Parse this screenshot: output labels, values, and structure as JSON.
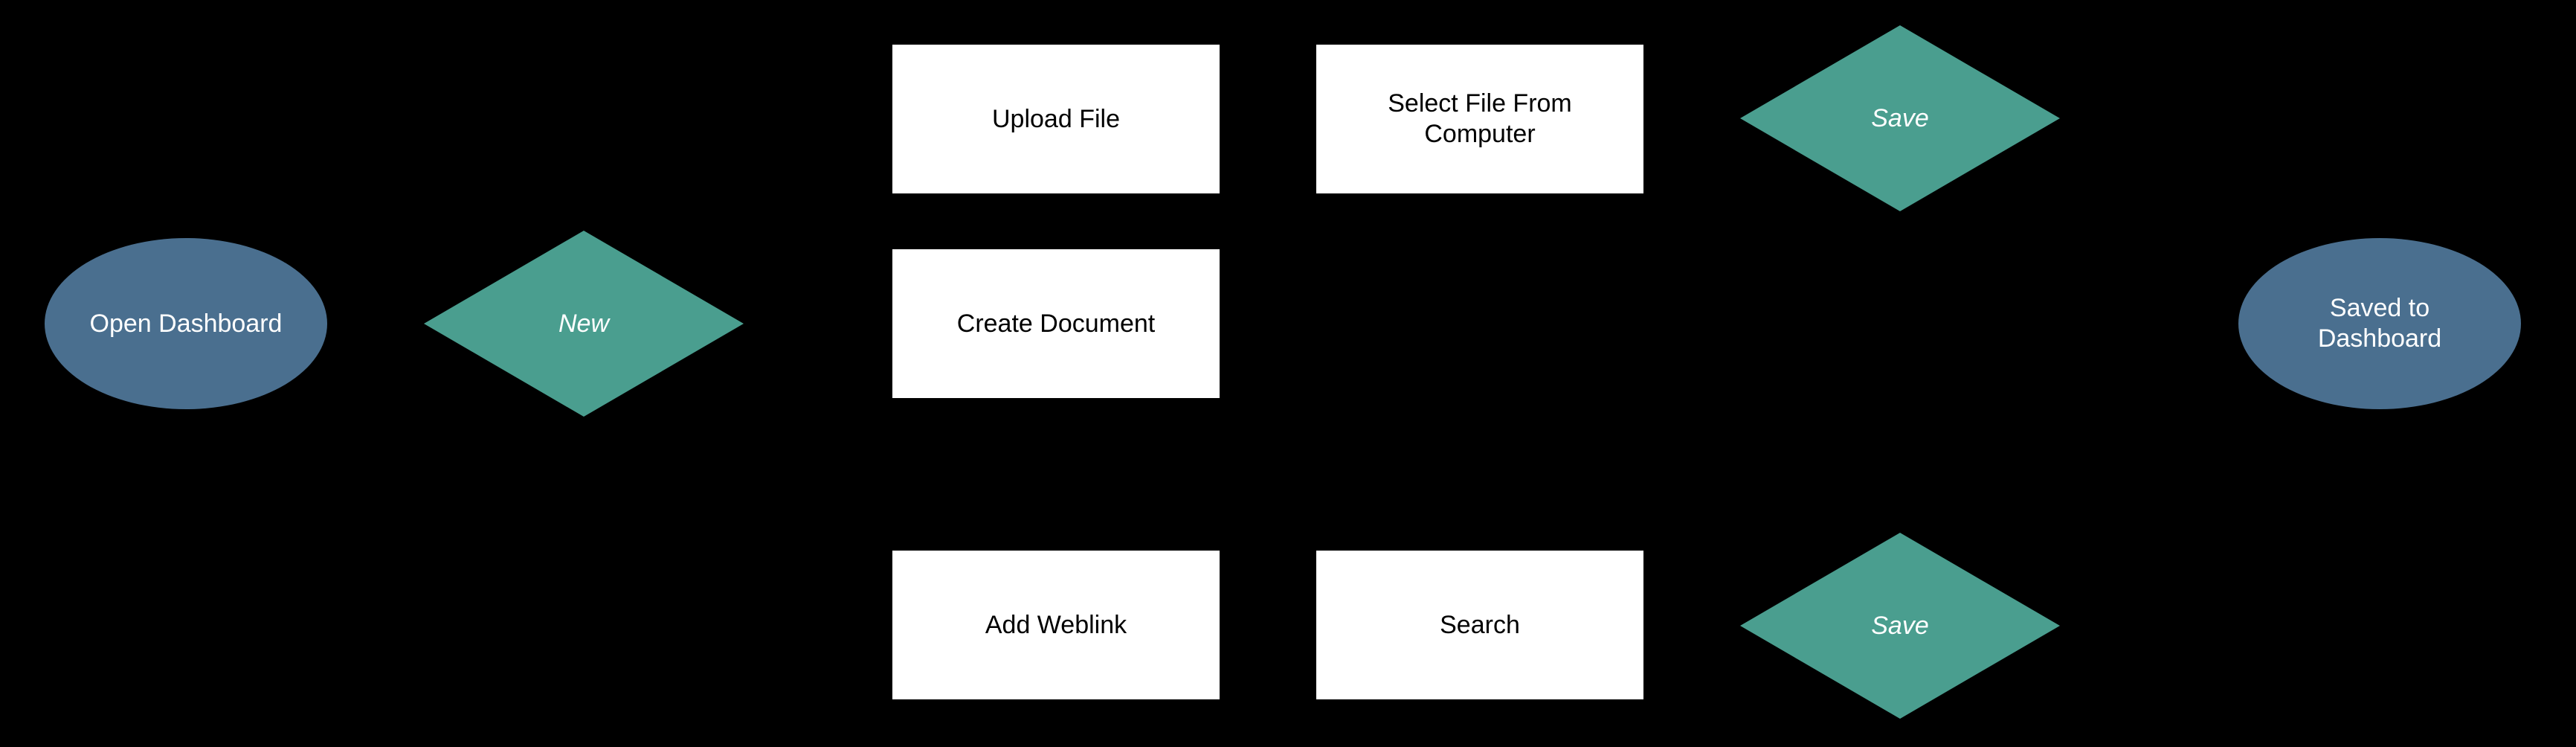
{
  "colors": {
    "ellipse_fill": "#4a6f8f",
    "diamond_fill": "#4a9e8f",
    "rect_fill": "#ffffff",
    "text_light": "#ffffff",
    "text_dark": "#000000"
  },
  "nodes": {
    "open_dashboard": {
      "label": "Open Dashboard",
      "shape": "ellipse"
    },
    "new": {
      "label": "New",
      "shape": "diamond"
    },
    "upload_file": {
      "label": "Upload File",
      "shape": "rect"
    },
    "create_document": {
      "label": "Create Document",
      "shape": "rect"
    },
    "add_weblink": {
      "label": "Add Weblink",
      "shape": "rect"
    },
    "select_file": {
      "label": "Select File From Computer",
      "shape": "rect"
    },
    "search": {
      "label": "Search",
      "shape": "rect"
    },
    "save_top": {
      "label": "Save",
      "shape": "diamond"
    },
    "save_bottom": {
      "label": "Save",
      "shape": "diamond"
    },
    "saved_dashboard": {
      "label": "Saved to Dashboard",
      "shape": "ellipse"
    }
  },
  "flow": [
    [
      "open_dashboard",
      "new"
    ],
    [
      "new",
      "upload_file"
    ],
    [
      "new",
      "create_document"
    ],
    [
      "new",
      "add_weblink"
    ],
    [
      "upload_file",
      "select_file"
    ],
    [
      "add_weblink",
      "search"
    ],
    [
      "select_file",
      "save_top"
    ],
    [
      "search",
      "save_bottom"
    ],
    [
      "save_top",
      "saved_dashboard"
    ],
    [
      "save_bottom",
      "saved_dashboard"
    ]
  ]
}
